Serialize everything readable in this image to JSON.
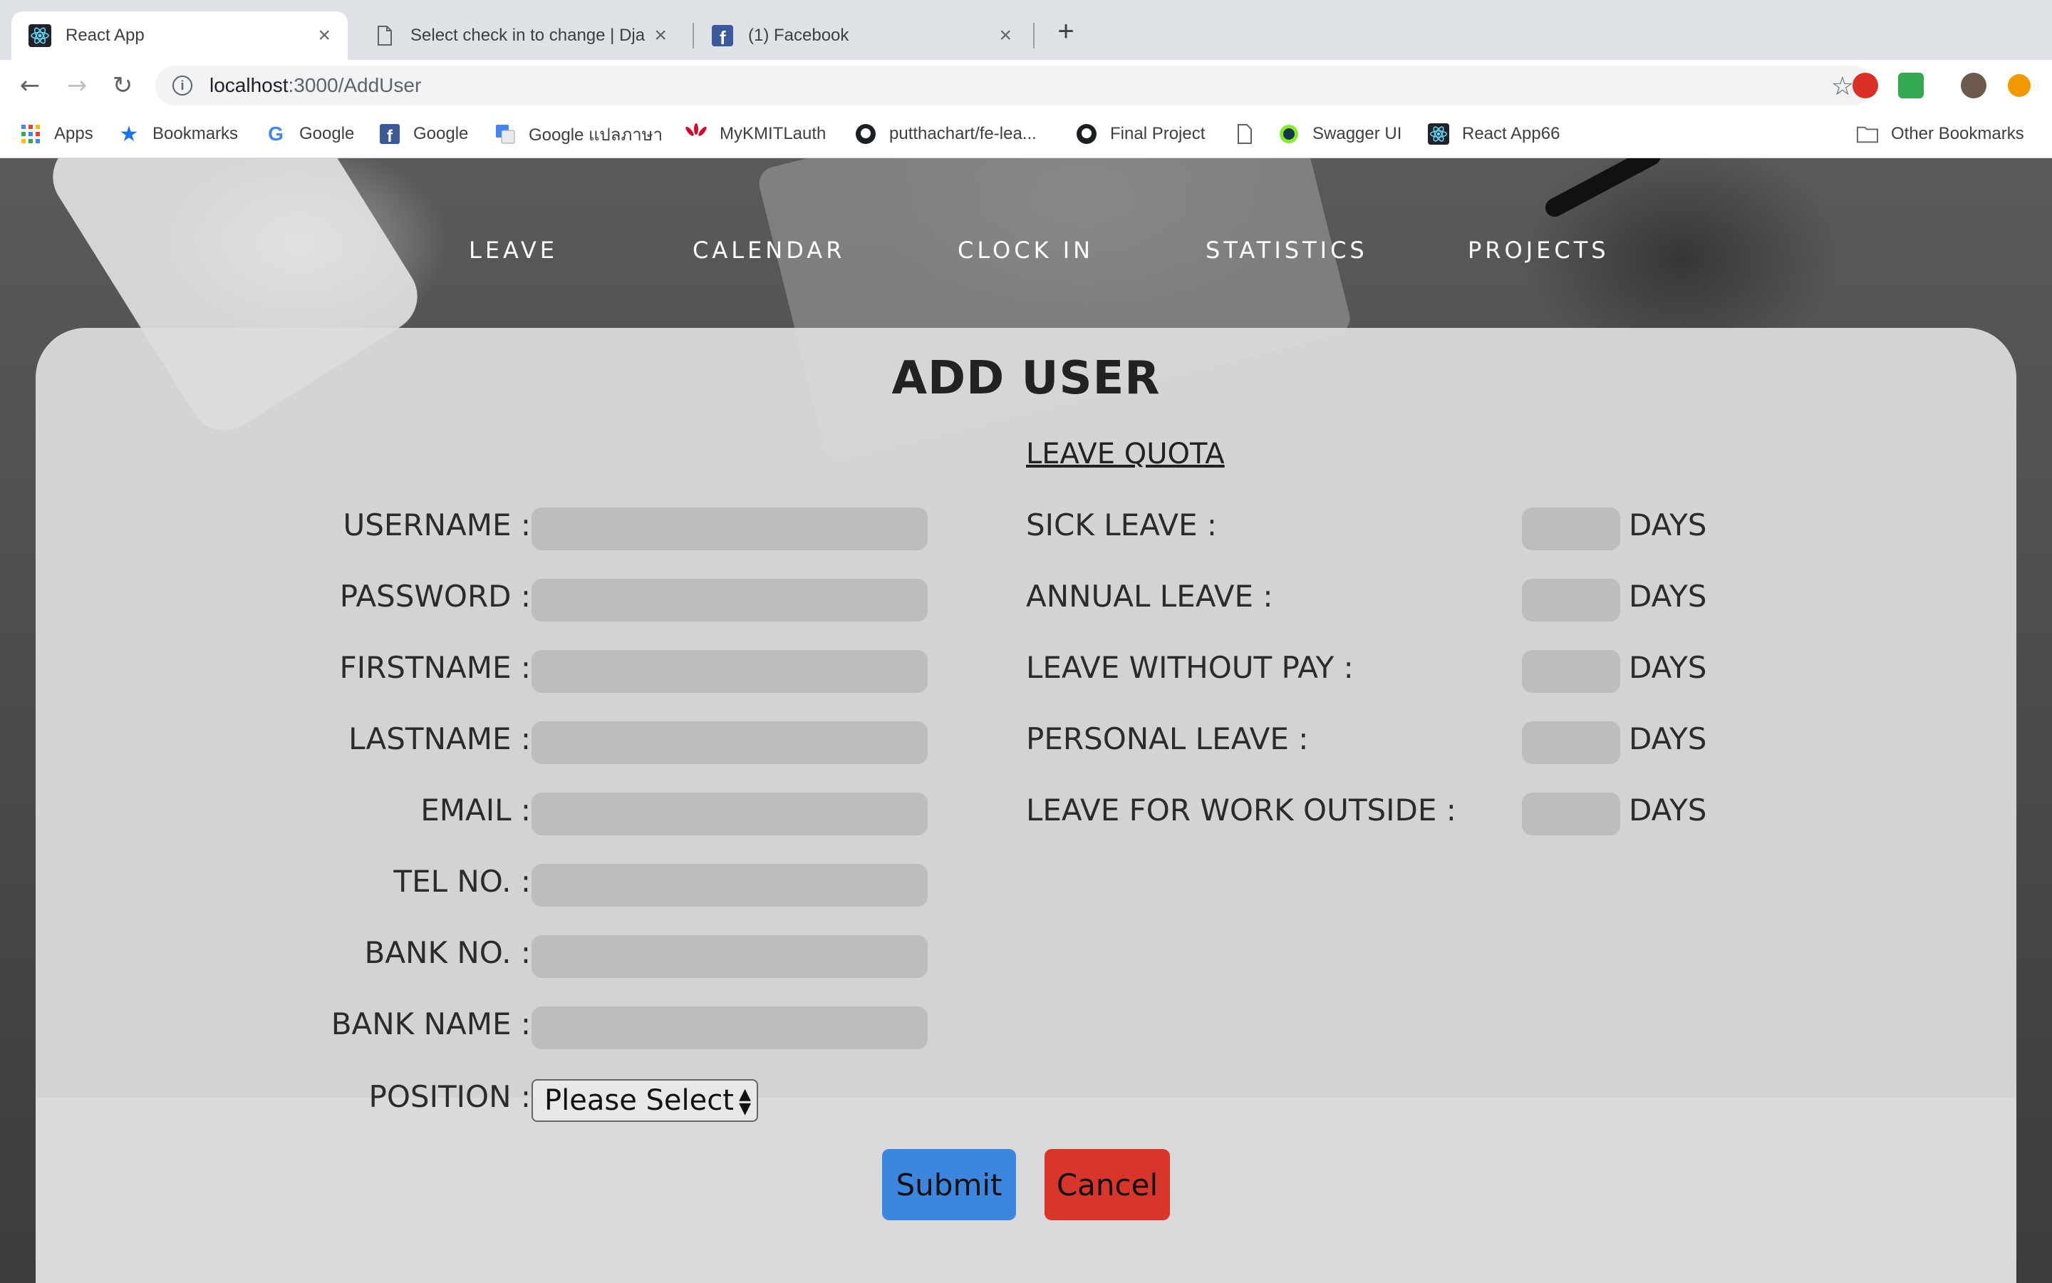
{
  "browser": {
    "tabs": [
      {
        "title": "React App",
        "active": true,
        "icon": "react-icon"
      },
      {
        "title": "Select check in to change | Dja",
        "active": false,
        "icon": "document-icon"
      },
      {
        "title": "(1) Facebook",
        "active": false,
        "icon": "facebook-icon"
      }
    ],
    "new_tab": "+",
    "url_host": "localhost",
    "url_path": ":3000/AddUser",
    "bookmarks": [
      {
        "label": "Apps",
        "icon": "apps-grid-icon"
      },
      {
        "label": "Bookmarks",
        "icon": "star-icon"
      },
      {
        "label": "Google",
        "icon": "google-icon"
      },
      {
        "label": "Google",
        "icon": "facebook-icon"
      },
      {
        "label": "Google แปลภาษา",
        "icon": "google-translate-icon"
      },
      {
        "label": "MyKMITLauth",
        "icon": "huawei-icon"
      },
      {
        "label": "putthachart/fe-lea...",
        "icon": "github-icon"
      },
      {
        "label": "Final Project",
        "icon": "github-icon"
      },
      {
        "label": "",
        "icon": "document-icon"
      },
      {
        "label": "Swagger UI",
        "icon": "swagger-icon"
      },
      {
        "label": "React App66",
        "icon": "react-icon"
      }
    ],
    "other_bookmarks": "Other Bookmarks"
  },
  "nav": {
    "leave": "LEAVE",
    "calendar": "CALENDAR",
    "clock_in": "CLOCK IN",
    "statistics": "STATISTICS",
    "projects": "PROJECTS"
  },
  "form": {
    "title": "ADD USER",
    "fields": [
      {
        "label": "USERNAME :",
        "value": ""
      },
      {
        "label": "PASSWORD :",
        "value": ""
      },
      {
        "label": "FIRSTNAME :",
        "value": ""
      },
      {
        "label": "LASTNAME :",
        "value": ""
      },
      {
        "label": "EMAIL :",
        "value": ""
      },
      {
        "label": "TEL NO. :",
        "value": ""
      },
      {
        "label": "BANK NO. :",
        "value": ""
      },
      {
        "label": "BANK NAME :",
        "value": ""
      }
    ],
    "position": {
      "label": "POSITION :",
      "selected": "Please Select"
    },
    "quota_title": "LEAVE QUOTA",
    "quota": [
      {
        "label": "SICK LEAVE :",
        "unit": "DAYS"
      },
      {
        "label": "ANNUAL LEAVE :",
        "unit": "DAYS"
      },
      {
        "label": "LEAVE WITHOUT PAY :",
        "unit": "DAYS"
      },
      {
        "label": "PERSONAL LEAVE :",
        "unit": "DAYS"
      },
      {
        "label": "LEAVE FOR WORK OUTSIDE :",
        "unit": "DAYS"
      }
    ],
    "submit": "Submit",
    "cancel": "Cancel"
  },
  "colors": {
    "submit": "#3d86de",
    "cancel": "#d9362b",
    "input": "#bdbdbd",
    "panel": "#dcdcdc"
  }
}
